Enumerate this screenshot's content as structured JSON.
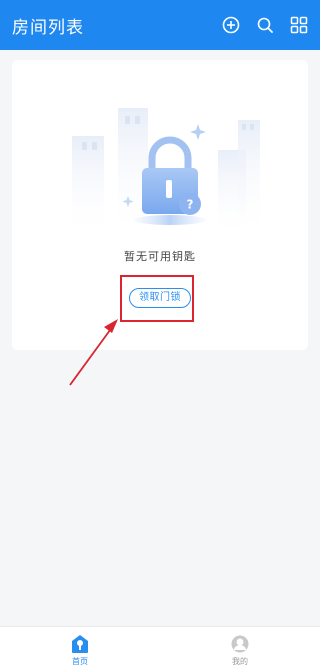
{
  "header": {
    "title": "房间列表",
    "icons": [
      "add-circle-icon",
      "search-icon",
      "grid-menu-icon"
    ]
  },
  "empty_state": {
    "message": "暂无可用钥匙",
    "button_label": "领取门锁"
  },
  "tabbar": {
    "items": [
      {
        "label": "首页",
        "icon": "home-key-icon",
        "active": true
      },
      {
        "label": "我的",
        "icon": "profile-avatar-icon",
        "active": false
      }
    ]
  },
  "colors": {
    "primary": "#1e88f0",
    "accent": "#2a8ef0",
    "annotation": "#d9252f",
    "background": "#f5f6f8"
  }
}
